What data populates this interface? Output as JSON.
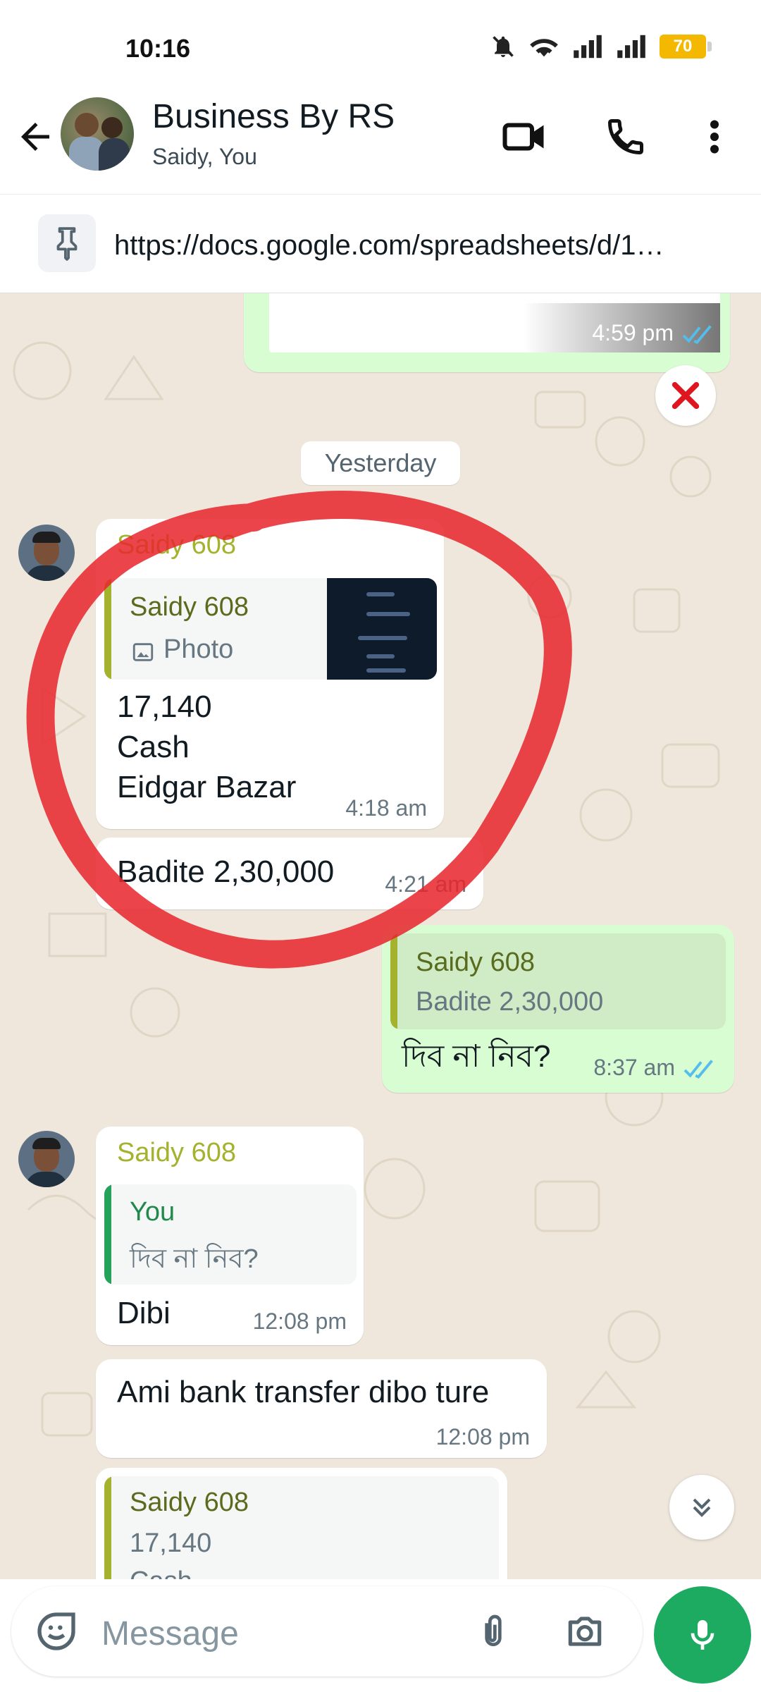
{
  "status_bar": {
    "time": "10:16",
    "battery": "70",
    "icons": [
      "bell-off-icon",
      "wifi-icon",
      "signal-icon",
      "signal-icon",
      "battery-icon"
    ]
  },
  "header": {
    "title": "Business By RS",
    "subtitle": "Saidy, You",
    "actions": [
      "video-call-icon",
      "phone-call-icon",
      "more-options-icon"
    ]
  },
  "pinned": {
    "text": "https://docs.google.com/spreadsheets/d/1…"
  },
  "chat": {
    "date_divider": "Yesterday",
    "messages": [
      {
        "direction": "out",
        "time": "4:59 pm",
        "status": "read"
      },
      {
        "direction": "in",
        "sender": "Saidy 608",
        "quote": {
          "name": "Saidy 608",
          "text": "Photo"
        },
        "lines": [
          "17,140",
          "Cash",
          "Eidgar Bazar"
        ],
        "time": "4:18 am"
      },
      {
        "direction": "in",
        "text": "Badite 2,30,000",
        "time": "4:21 am"
      },
      {
        "direction": "out",
        "quote": {
          "name": "Saidy 608",
          "text": "Badite 2,30,000"
        },
        "text": "দিব না নিব?",
        "time": "8:37 am",
        "status": "read"
      },
      {
        "direction": "in",
        "sender": "Saidy 608",
        "quote": {
          "name": "You",
          "text": "দিব না নিব?"
        },
        "text": "Dibi",
        "time": "12:08 pm"
      },
      {
        "direction": "in",
        "text": "Ami bank transfer dibo ture",
        "time": "12:08 pm"
      },
      {
        "direction": "in",
        "quote": {
          "name": "Saidy 608",
          "text": "17,140",
          "text2": "Cash"
        }
      }
    ]
  },
  "composer": {
    "placeholder": "Message",
    "icons": [
      "sticker-icon",
      "attach-icon",
      "camera-icon",
      "mic-icon"
    ]
  },
  "colors": {
    "accent": "#1daa61",
    "outgoing_bubble": "#d9fdd3",
    "sender_name": "#a4b22d",
    "read_ticks": "#53bdeb",
    "annotation": "#e8242b"
  }
}
